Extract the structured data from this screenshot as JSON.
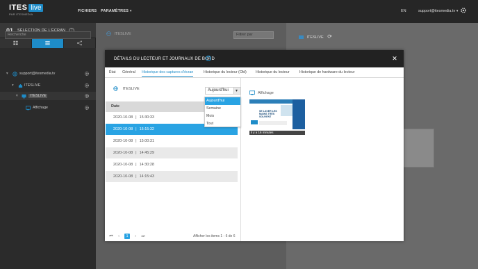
{
  "header": {
    "logo_main": "ITES",
    "logo_live": "live",
    "logo_sub": "PAR ITESMEDIA",
    "menu": [
      "FICHIERS",
      "PARAMÈTRES"
    ],
    "lang": "EN",
    "user": "support@itesmedia.tv"
  },
  "sidebar": {
    "step_number": "01",
    "step_title": "SÉLECTION DE L'ÉCRAN",
    "search_placeholder": "Recherche",
    "tree": [
      {
        "label": "support@itesmedia.tv"
      },
      {
        "label": "ITESLIVE"
      },
      {
        "label": "ITESLIVE"
      },
      {
        "label": "Affichage"
      }
    ]
  },
  "main": {
    "item_label": "ITESLIVE",
    "filter_label": "Filtrer par"
  },
  "right_panel": {
    "item_label": "ITESLIVE"
  },
  "modal": {
    "title": "DÉTAILS DU LECTEUR ET JOURNAUX DE BORD",
    "tabs": [
      "État",
      "Général",
      "Historique des captures d'écran",
      "Historique du lecteur (Old)",
      "Historique du lecteur",
      "Historique de hardware du lecteur"
    ],
    "active_tab_index": 2,
    "player_label": "ITESLIVE",
    "period_selected": "Aujourd'hui",
    "period_options": [
      "Aujourd'hui",
      "Semaine",
      "Mois",
      "Tout"
    ],
    "grid_header": "Date",
    "grid_rows": [
      {
        "date": "2020-10-08",
        "sep": "|",
        "time": "15:30:33"
      },
      {
        "date": "2020-10-08",
        "sep": "|",
        "time": "15:15:32"
      },
      {
        "date": "2020-10-08",
        "sep": "|",
        "time": "15:00:31"
      },
      {
        "date": "2020-10-08",
        "sep": "|",
        "time": "14:45:29"
      },
      {
        "date": "2020-10-08",
        "sep": "|",
        "time": "14:30:28"
      },
      {
        "date": "2020-10-08",
        "sep": "|",
        "time": "14:15:43"
      }
    ],
    "pager": {
      "current_page": "1",
      "info": "Afficher les items 1 - 6 de 6"
    },
    "display_label": "Affichage",
    "screenshot_caption": "il y a 16 minutes",
    "screenshot_text": "SE LAVER LES MAINS TRÈS SOUVENT"
  },
  "colors": {
    "accent": "#1e8cc8",
    "selected_row": "#29a3e3",
    "topbar": "#262626",
    "sidebar": "#2b2b2b"
  }
}
